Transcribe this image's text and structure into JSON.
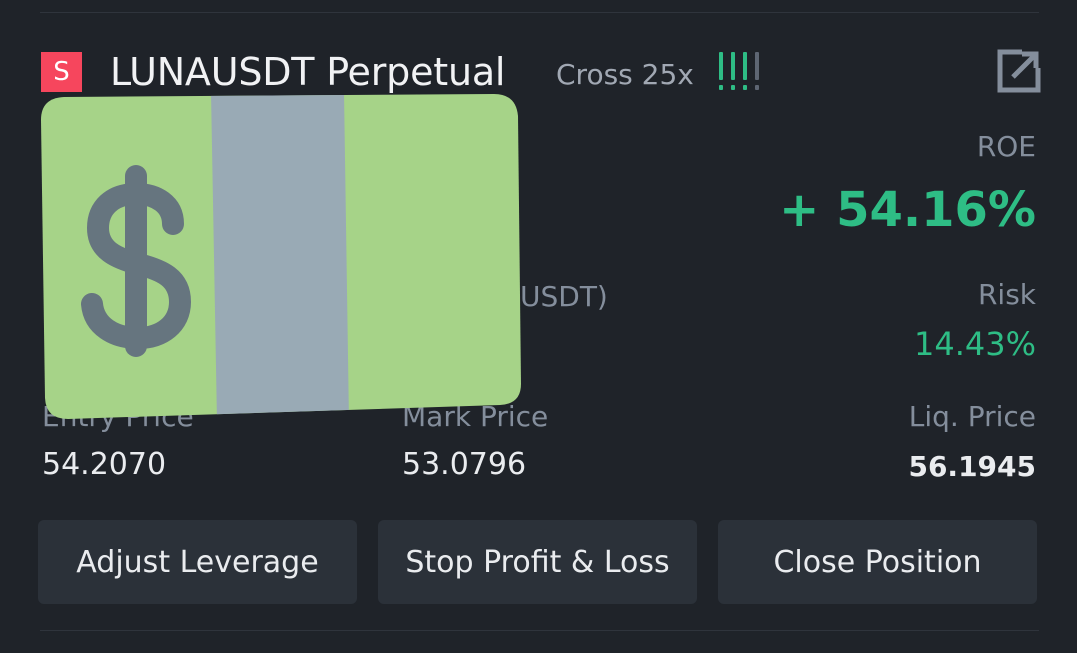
{
  "position": {
    "side_badge": "S",
    "symbol": "LUNAUSDT Perpetual",
    "margin_mode": "Cross 25x",
    "share_icon": "external-share-icon",
    "strength_indicator": {
      "active_bars": 3,
      "total_bars": 4,
      "color": "#2ebd85"
    }
  },
  "stats": {
    "roe_label": "ROE",
    "roe_value": "+ 54.16%",
    "risk_label": "Risk",
    "risk_value": "14.43%",
    "size_label_fragment": "USDT)",
    "entry_price_label": "Entry Price",
    "entry_price_value": "54.2070",
    "mark_price_label": "Mark Price",
    "mark_price_value": "53.0796",
    "liq_price_label": "Liq. Price",
    "liq_price_value": "56.1945"
  },
  "actions": {
    "adjust_leverage": "Adjust Leverage",
    "stop_profit_loss": "Stop Profit & Loss",
    "close_position": "Close Position"
  },
  "overlay": {
    "icon": "dollar-banknote-icon"
  },
  "colors": {
    "background": "#1f2329",
    "positive": "#2ebd85",
    "sell_badge": "#f6465d",
    "button": "#2b3139"
  }
}
